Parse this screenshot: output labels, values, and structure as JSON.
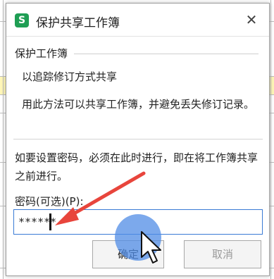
{
  "dialog": {
    "title": "保护共享工作簿",
    "app_icon_letter": "S",
    "close_symbol": "✕"
  },
  "group": {
    "label": "保护工作簿",
    "checkbox_label": "以追踪修订方式共享",
    "description": "用此方法可以共享工作簿，并避免丢失修订记录。"
  },
  "password": {
    "description": "如要设置密码，必须在此时进行，即在将工作簿共享之前进行。",
    "label": "密码(可选)(P):",
    "value": "******"
  },
  "buttons": {
    "ok": "确定",
    "cancel": "取消"
  },
  "colors": {
    "accent": "#3a7bd5",
    "arrow": "#e8453c",
    "click_highlight": "#508ce6",
    "app_icon": "#1f9e54"
  }
}
